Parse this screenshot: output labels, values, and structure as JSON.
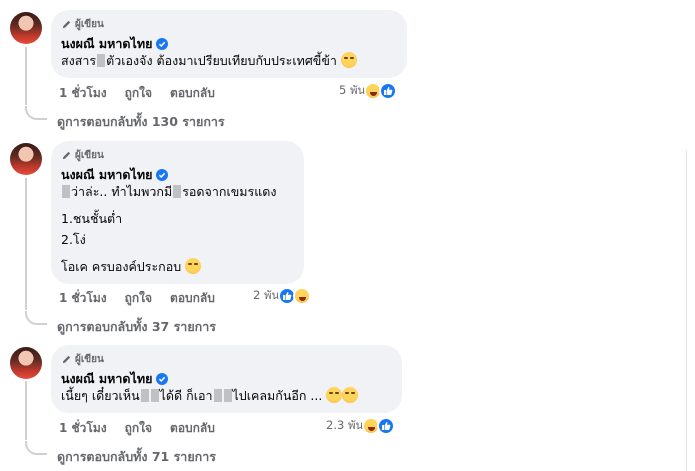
{
  "badge_label": "ผู้เขียน",
  "author": "นงผณี มหาดไทย",
  "comments": [
    {
      "lines": [
        "สงสาร",
        "ตัวเองจัง ต้องมาเปรียบเทียบกับประเทศขี้ข้า"
      ],
      "time": "1 ชั่วโมง",
      "like": "ถูกใจ",
      "reply": "ตอบกลับ",
      "reaction_count": "5 พัน",
      "reactions": [
        "haha-icon",
        "like-icon"
      ],
      "replies_link": "ดูการตอบกลับทั้ง 130 รายการ"
    },
    {
      "line1": [
        "ว่าล่ะ.. ทำไมพวกมี",
        "รอดจากเขมรแดง"
      ],
      "line2": "1.ชนชั้นต่ำ",
      "line3": "2.โง่",
      "line4": "โอเค ครบองค์ประกอบ",
      "time": "1 ชั่วโมง",
      "like": "ถูกใจ",
      "reply": "ตอบกลับ",
      "reaction_count": "2 พัน",
      "reactions": [
        "like-icon",
        "haha-icon"
      ],
      "replies_link": "ดูการตอบกลับทั้ง 37 รายการ"
    },
    {
      "line1": [
        "เนี้ยๆ เดี๋ยวเห็น",
        "ได้ดี ก็เอา",
        "ไปเคลมกันอีก ..."
      ],
      "time": "1 ชั่วโมง",
      "like": "ถูกใจ",
      "reply": "ตอบกลับ",
      "reaction_count": "2.3 พัน",
      "reactions": [
        "haha-icon",
        "like-icon"
      ],
      "replies_link": "ดูการตอบกลับทั้ง 71 รายการ"
    }
  ],
  "colors": {
    "bubble": "#f0f2f5",
    "meta": "#65676b",
    "like_blue": "#1877f2"
  }
}
